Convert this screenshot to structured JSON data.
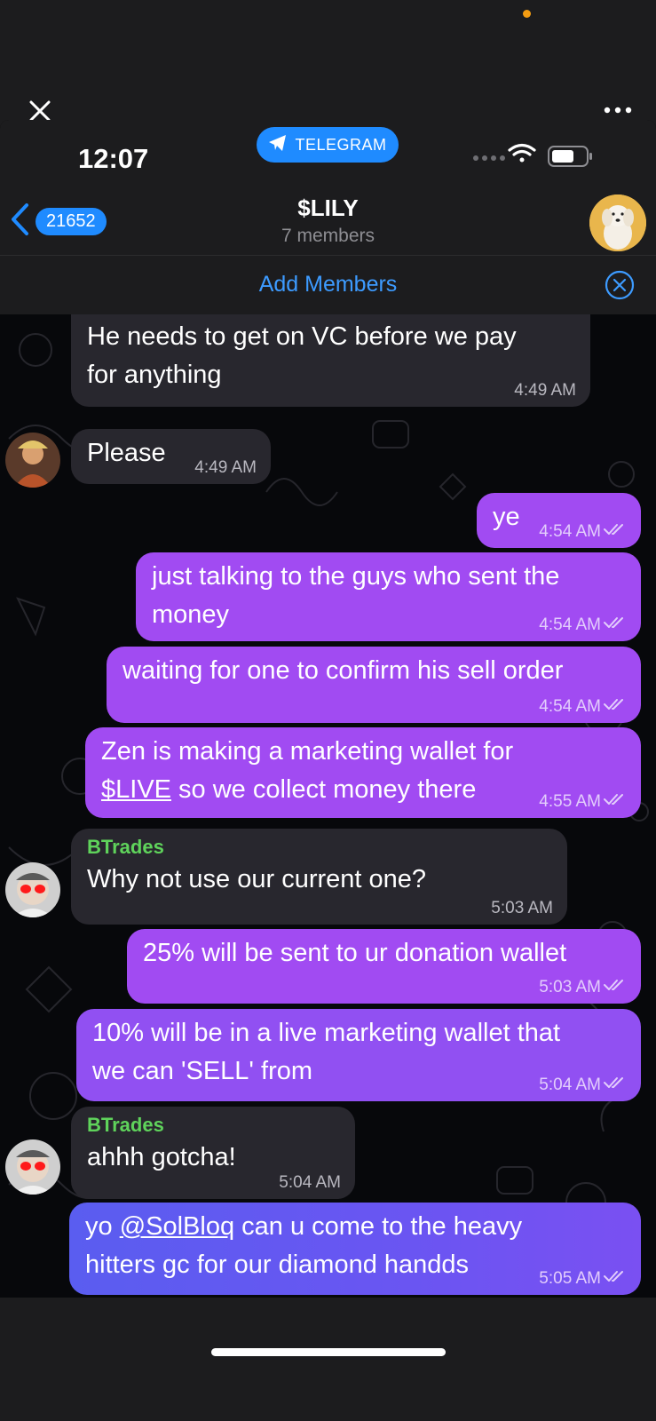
{
  "browser": {
    "close_icon": "close-icon",
    "more_icon": "more-dots-icon"
  },
  "status": {
    "time": "12:07",
    "app_pill": "TELEGRAM"
  },
  "header": {
    "back_count": "21652",
    "title": "$LILY",
    "subtitle": "7 members"
  },
  "add_members": {
    "label": "Add Members"
  },
  "colors": {
    "accent": "#1f8bff",
    "outgoing_bubble": "#a14bf2",
    "incoming_bubble": "#28272e",
    "sender_name": "#5fd35b"
  },
  "messages": [
    {
      "text": "He needs to get on VC before we pay\nfor anything",
      "time": "4:49 AM"
    },
    {
      "text": "Please",
      "time": "4:49 AM"
    },
    {
      "text": "ye",
      "time": "4:54 AM"
    },
    {
      "text": "just talking to the guys who sent the\nmoney",
      "time": "4:54 AM"
    },
    {
      "text": "waiting for one to confirm his sell order",
      "time": "4:54 AM"
    },
    {
      "text_pre": "Zen is making a marketing wallet for",
      "link": "$LIVE",
      "text_post": " so we collect money there",
      "time": "4:55 AM"
    },
    {
      "sender": "BTrades",
      "text": "Why not use our current one?",
      "time": "5:03 AM"
    },
    {
      "text": "25% will be sent to ur donation wallet",
      "time": "5:03 AM"
    },
    {
      "text": "10% will be in a live marketing wallet that\nwe can 'SELL' from",
      "time": "5:04 AM"
    },
    {
      "sender": "BTrades",
      "text": "ahhh gotcha!",
      "time": "5:04 AM"
    },
    {
      "text_pre": "yo ",
      "link": "@SolBloq",
      "text_post": " can u come to the heavy\nhitters gc for our diamond handds",
      "time": "5:05 AM"
    }
  ]
}
